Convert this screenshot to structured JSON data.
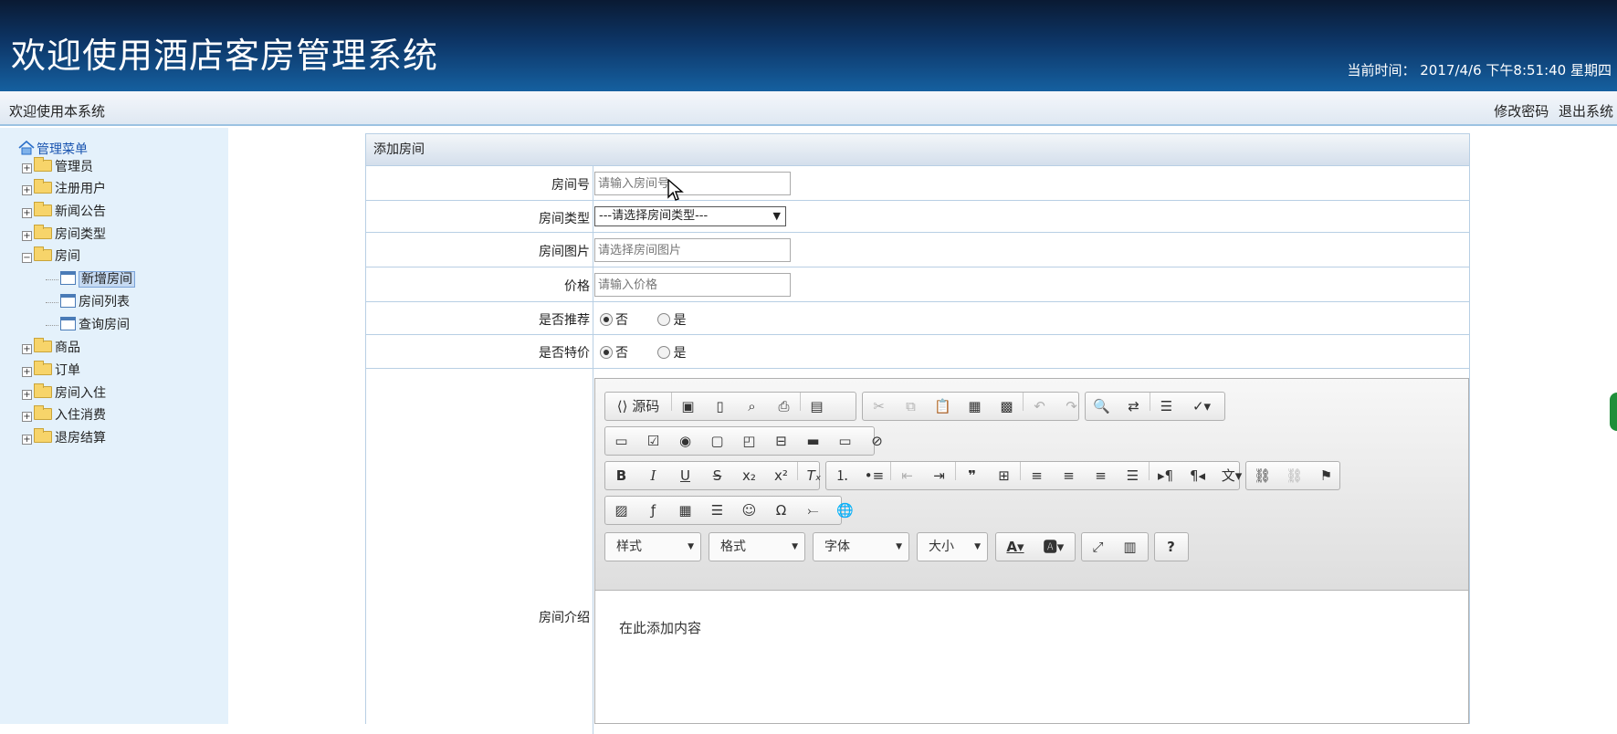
{
  "header": {
    "title": "欢迎使用酒店客房管理系统",
    "clock_label": "当前时间：",
    "clock_value": "2017/4/6 下午8:51:40 星期四"
  },
  "topbar": {
    "welcome": "欢迎使用本系统",
    "change_password": "修改密码",
    "logout": "退出系统"
  },
  "sidebar": {
    "root": "管理菜单",
    "items": [
      {
        "label": "管理员"
      },
      {
        "label": "注册用户"
      },
      {
        "label": "新闻公告"
      },
      {
        "label": "房间类型"
      },
      {
        "label": "房间"
      },
      {
        "label": "新增房间"
      },
      {
        "label": "房间列表"
      },
      {
        "label": "查询房间"
      },
      {
        "label": "商品"
      },
      {
        "label": "订单"
      },
      {
        "label": "房间入住"
      },
      {
        "label": "入住消费"
      },
      {
        "label": "退房结算"
      }
    ]
  },
  "form": {
    "caption": "添加房间",
    "room_no": {
      "label": "房间号",
      "placeholder": "请输入房间号"
    },
    "room_type": {
      "label": "房间类型",
      "selected": "---请选择房间类型---"
    },
    "room_image": {
      "label": "房间图片",
      "placeholder": "请选择房间图片"
    },
    "price": {
      "label": "价格",
      "placeholder": "请输入价格"
    },
    "recommend": {
      "label": "是否推荐",
      "options": [
        "否",
        "是"
      ],
      "selected": "否"
    },
    "special": {
      "label": "是否特价",
      "options": [
        "否",
        "是"
      ],
      "selected": "否"
    },
    "intro": {
      "label": "房间介绍"
    }
  },
  "editor": {
    "source_label": "源码",
    "combo_style": "样式",
    "combo_format": "格式",
    "combo_font": "字体",
    "combo_size": "大小",
    "content": "在此添加内容"
  },
  "colors": {
    "header_dark": "#0a1a33",
    "header_light": "#1560a0",
    "sidebar_bg": "#e4f1fb",
    "border": "#b8cfe4"
  }
}
